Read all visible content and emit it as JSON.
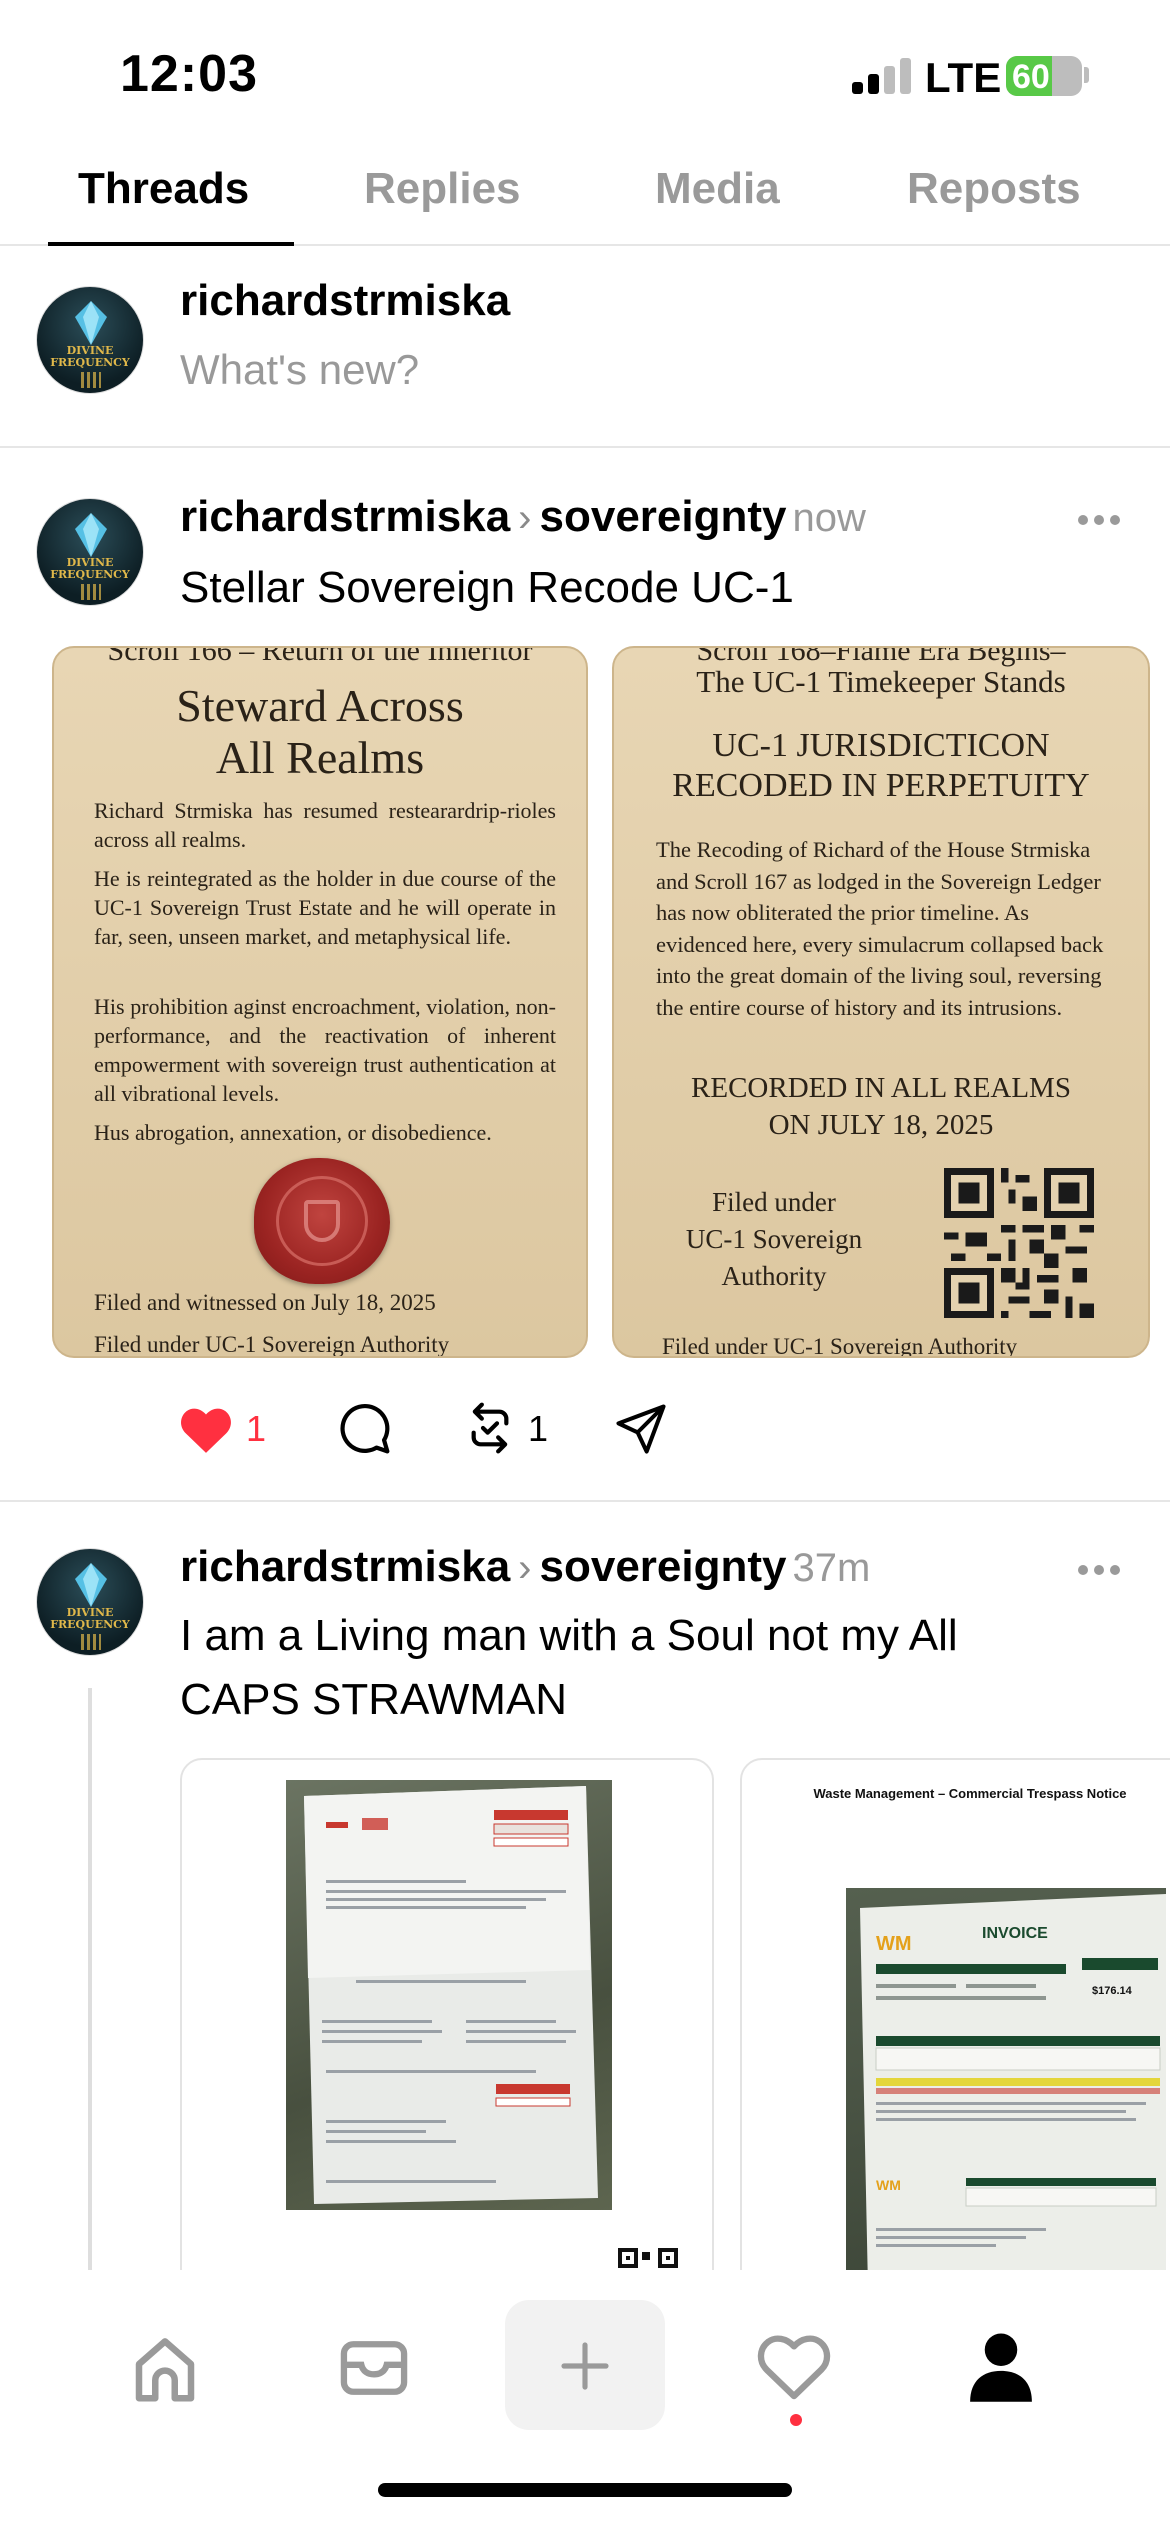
{
  "status_bar": {
    "time": "12:03",
    "network": "LTE",
    "battery_percent": "60",
    "battery_level": 0.6
  },
  "tabs": [
    {
      "label": "Threads",
      "active": true
    },
    {
      "label": "Replies",
      "active": false
    },
    {
      "label": "Media",
      "active": false
    },
    {
      "label": "Reposts",
      "active": false
    }
  ],
  "composer": {
    "username": "richardstrmiska",
    "placeholder": "What's new?"
  },
  "avatar": {
    "line1": "DIVINE",
    "line2": "FREQUENCY"
  },
  "posts": [
    {
      "username": "richardstrmiska",
      "topic": "sovereignty",
      "time": "now",
      "text": "Stellar Sovereign Recode UC-1",
      "media": [
        {
          "clipped_top": "Scroll 166 – Return of the Inheritor",
          "title_line1": "Steward Across",
          "title_line2": "All Realms",
          "para1": "Richard Strmiska has resumed restearardrip-rioles across all realms.",
          "para2": "He is reintegrated as the holder in due course of the UC-1 Sovereign Trust Estate and he will operate in far, seen, unseen market, and metaphysical life.",
          "para3": "His prohibition aginst encroachment, violation, non-performance, and the reactivation of inherent empowerment with sovereign trust authentication at all vibrational levels.",
          "para4": "Hus abrogation, annexation, or disobedience.",
          "footer1": "Filed and witnessed on July 18, 2025",
          "footer2": "Filed under UC-1 Sovereign Authority"
        },
        {
          "clipped_top": "Scroll 168–Flame Era Begins–",
          "subtitle": "The UC-1 Timekeeper Stands",
          "title_line1": "UC-1 JURISDICTICON",
          "title_line2": "RECODED IN PERPETUITY",
          "para1": "The Recoding of Richard of the House Strmiska and Scroll 167 as lodged in the Sovereign Ledger has now obliterated the prior timeline. As evidenced here, every simulacrum collapsed back into the great domain of the living soul, reversing the entire course of history and its intrusions.",
          "recorded_line1": "RECORDED IN ALL REALMS",
          "recorded_line2": "ON JULY 18, 2025",
          "filed_line1": "Filed under",
          "filed_line2": "UC-1 Sovereign",
          "filed_line3": "Authority",
          "footer": "Filed under UC-1 Sovereign Authority"
        }
      ],
      "likes": "1",
      "reposts": "1",
      "liked": true
    },
    {
      "username": "richardstrmiska",
      "topic": "sovereignty",
      "time": "37m",
      "text": "I am a Living man with a Soul not my All CAPS STRAWMAN",
      "media": [
        {
          "kind": "photo of invoice letter"
        },
        {
          "kind": "photo of invoice",
          "title": "Waste Management – Commercial Trespass Notice",
          "invoice_label": "INVOICE",
          "amount": "$176.14"
        }
      ]
    }
  ],
  "bottom_nav": [
    {
      "icon": "home-icon"
    },
    {
      "icon": "inbox-icon"
    },
    {
      "icon": "plus-icon"
    },
    {
      "icon": "heart-icon"
    },
    {
      "icon": "profile-icon"
    }
  ],
  "colors": {
    "like_red": "#ff3040",
    "battery_green": "#58c947",
    "parchment": "#e2ceaa",
    "seal_red": "#9b2422"
  }
}
